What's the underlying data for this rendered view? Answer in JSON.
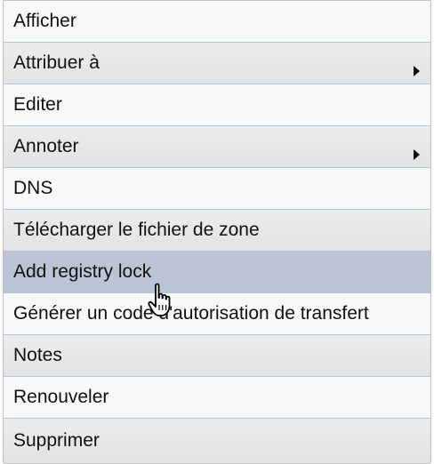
{
  "menu": {
    "items": [
      {
        "label": "Afficher"
      },
      {
        "label": "Attribuer à"
      },
      {
        "label": "Editer"
      },
      {
        "label": "Annoter"
      },
      {
        "label": "DNS"
      },
      {
        "label": "Télécharger le fichier de zone"
      },
      {
        "label": "Add registry lock"
      },
      {
        "label": "Générer un code d'autorisation de transfert"
      },
      {
        "label": "Notes"
      },
      {
        "label": "Renouveler"
      },
      {
        "label": "Supprimer"
      }
    ]
  },
  "cursor": {
    "icon": "hand-pointer-icon"
  }
}
